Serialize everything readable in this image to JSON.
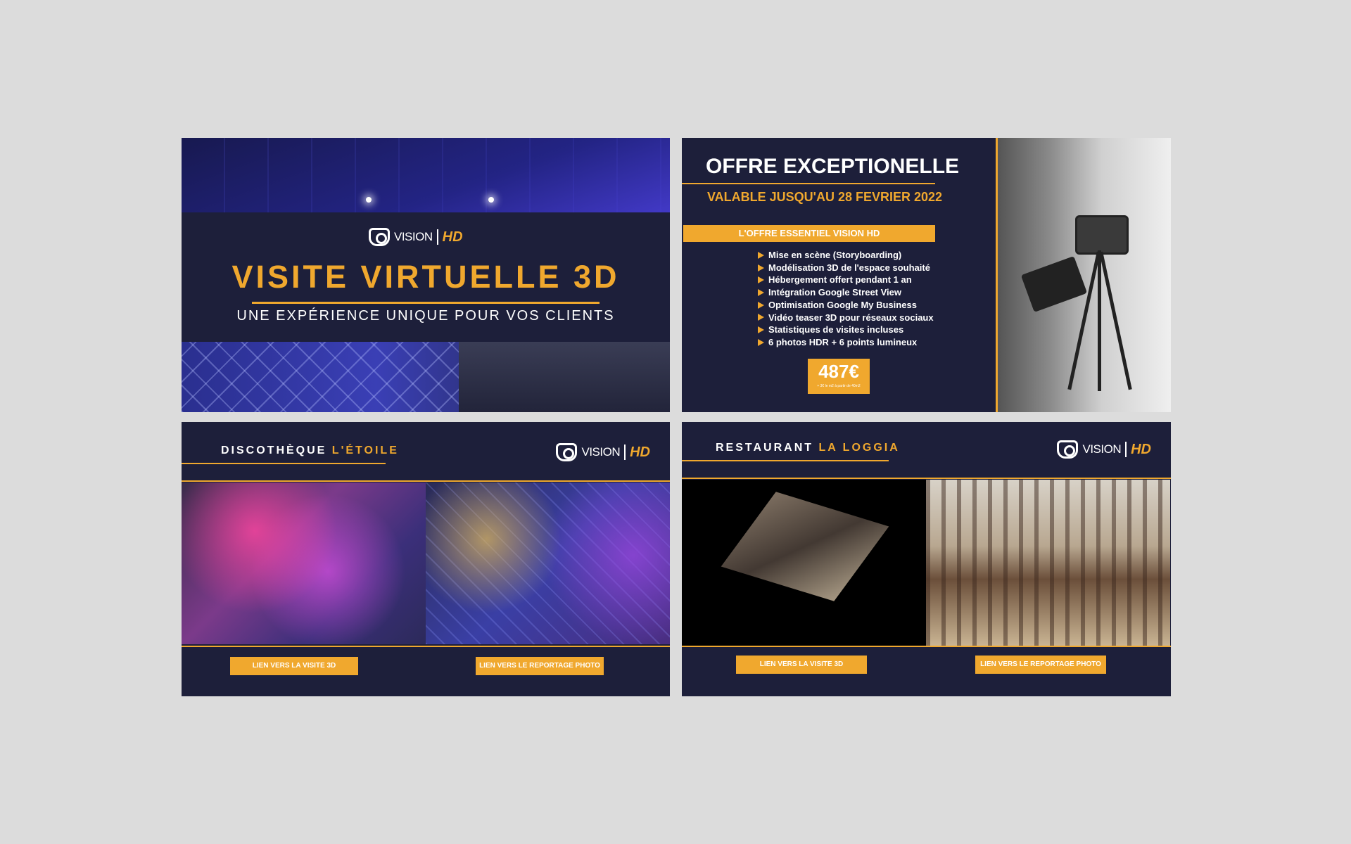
{
  "brand": {
    "logo_word": "VISION",
    "logo_hd": "HD",
    "accent_color": "#f0a82e",
    "bg_color": "#1d1f3a"
  },
  "panel1": {
    "title": "VISITE VIRTUELLE 3D",
    "subtitle": "UNE EXPÉRIENCE UNIQUE POUR VOS CLIENTS"
  },
  "panel2": {
    "title": "OFFRE EXCEPTIONELLE",
    "validity": "VALABLE JUSQU'AU 28 FEVRIER 2022",
    "offer_label": "L'OFFRE ESSENTIEL VISION HD",
    "features": [
      "Mise en scène (Storyboarding)",
      "Modélisation 3D de l'espace souhaité",
      "Hébergement offert pendant 1 an",
      "Intégration Google Street View",
      "Optimisation Google My Business",
      "Vidéo teaser 3D pour réseaux sociaux",
      "Statistiques de visites incluses",
      "6 photos HDR + 6 points lumineux"
    ],
    "price": "487€",
    "price_note": "+ 3€ le m2 à partir de 40m2"
  },
  "panel3": {
    "title_prefix": "DISCOTHÈQUE",
    "title_accent": "L'ÉTOILE",
    "button_3d": "LIEN VERS LA VISITE 3D",
    "button_photo": "LIEN VERS LE REPORTAGE PHOTO"
  },
  "panel4": {
    "title_prefix": "RESTAURANT",
    "title_accent": "LA LOGGIA",
    "button_3d": "LIEN VERS LA VISITE 3D",
    "button_photo": "LIEN VERS LE REPORTAGE PHOTO"
  }
}
